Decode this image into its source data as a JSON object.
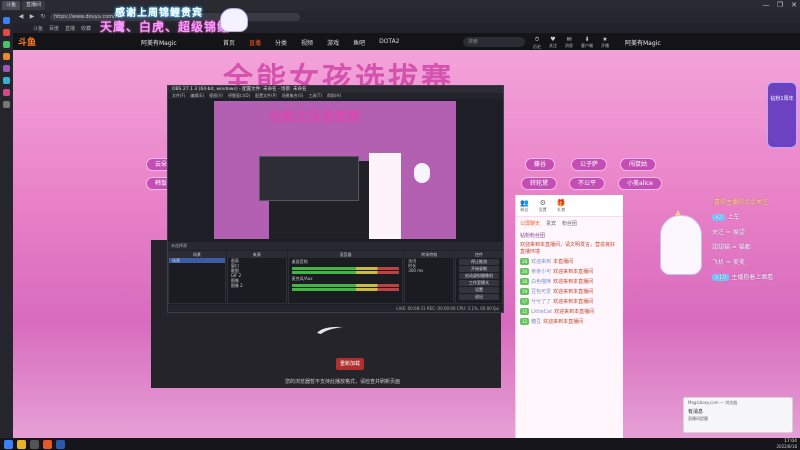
{
  "browser": {
    "tabs": [
      {
        "label": "斗鱼"
      },
      {
        "label": "直播间"
      }
    ],
    "window_controls": {
      "minimize": "—",
      "maximize": "❐",
      "close": "✕"
    },
    "url": "https://www.douyu.com/...",
    "bookmarks": [
      "斗鱼",
      "百度",
      "直播",
      "收藏"
    ]
  },
  "overlay": {
    "title": "感谢上周锦鲤贵宾",
    "subtitle": "天鹰、白虎、超级锦鲤"
  },
  "site": {
    "logo": "斗鱼",
    "streamer": "阿美有Magic",
    "nav": [
      {
        "label": "首页"
      },
      {
        "label": "直播",
        "active": true
      },
      {
        "label": "分类"
      },
      {
        "label": "视频"
      },
      {
        "label": "游戏"
      },
      {
        "label": "鱼吧"
      },
      {
        "label": "DOTA2"
      }
    ],
    "search_placeholder": "搜索",
    "header_icons": [
      {
        "icon": "⏱",
        "label": "历史"
      },
      {
        "icon": "♥",
        "label": "关注"
      },
      {
        "icon": "✉",
        "label": "消息"
      },
      {
        "icon": "⬇",
        "label": "客户端"
      },
      {
        "icon": "★",
        "label": "开播"
      }
    ],
    "user": "阿美有Magic"
  },
  "stage": {
    "title": "全能女孩选拔赛",
    "pills_left": [
      "云朵",
      "韩饭"
    ],
    "pills_right": [
      "藤谷",
      "公子萨",
      "闯鼠姑",
      "转轮黛",
      "不公平",
      "小美alice"
    ]
  },
  "player": {
    "button": "重新加载",
    "message": "您的浏览器暂不支持此播放格式，请检查并刷新页面"
  },
  "chat": {
    "top": [
      {
        "icon": "👥",
        "label": "粉丝"
      },
      {
        "icon": "⚙",
        "label": "设置"
      },
      {
        "icon": "🎁",
        "label": "礼物"
      }
    ],
    "tabs": [
      {
        "label": "公屏聊天",
        "active": true
      },
      {
        "label": "贵宾"
      },
      {
        "label": "粉丝团"
      }
    ],
    "rank": "钻粉粉丝团",
    "lines": [
      {
        "badge": "",
        "user": "",
        "text": "欢迎来到本直播间，请文明发言，营造良好直播环境"
      },
      {
        "badge": "28",
        "user": "欢迎来到",
        "text": "本直播间"
      },
      {
        "badge": "20",
        "user": "亲亲小可",
        "text": "欢迎来到本直播间"
      },
      {
        "badge": "18",
        "user": "白色喵咪",
        "text": "欢迎来到本直播间"
      },
      {
        "badge": "19",
        "user": "豆包可爱",
        "text": "欢迎来到本直播间"
      },
      {
        "badge": "17",
        "user": "兮兮了了",
        "text": "欢迎来到本直播间"
      },
      {
        "badge": "15",
        "user": "LittleCat",
        "text": "欢迎来到本直播间"
      },
      {
        "badge": "12",
        "user": "糖豆",
        "text": "欢迎来到本直播间"
      }
    ]
  },
  "side_panel": {
    "anniversary": "钻粉1周年",
    "gift_title": "喜欢主播的点点关注",
    "gift_lines": [
      {
        "badge": "x2",
        "text": "上车"
      },
      {
        "badge": "",
        "text": "关注 = 展望"
      },
      {
        "badge": "",
        "text": "甜甜猫 = 猫都"
      },
      {
        "badge": "",
        "text": "飞机 = 美美"
      },
      {
        "badge": "x10",
        "text": "主播抱着上面看"
      }
    ]
  },
  "obs": {
    "title": "OBS 27.1.3 (64-bit, windows) - 配置文件: 未命名 - 场景: 未命名",
    "menu": [
      "文件(F)",
      "编辑(E)",
      "视图(V)",
      "停靠窗口(D)",
      "配置文件(P)",
      "场景集合(S)",
      "工具(T)",
      "帮助(H)"
    ],
    "preview_title": "全能女孩选拔赛",
    "toolbar": "未选择源",
    "docks": {
      "scenes": {
        "header": "场景",
        "items": [
          "场景"
        ]
      },
      "sources": {
        "header": "来源",
        "items": [
          "画面",
          "窗口",
          "截图",
          "GIF 2",
          "图像",
          "图像 2"
        ]
      },
      "mixer": {
        "header": "混音器",
        "rows": [
          "桌面音频",
          "麦克风/Aux"
        ]
      },
      "transitions": {
        "header": "转场特效",
        "type": "淡出",
        "duration_label": "时长",
        "duration": "300 ms"
      },
      "controls": {
        "header": "控件",
        "buttons": [
          "停止推流",
          "开始录制",
          "启动虚拟摄像机",
          "工作室模式",
          "设置",
          "退出"
        ]
      }
    },
    "status": "LIVE: 00:08:31  REC: 00:00:00  CPU: 3.1%, 60.00 fps"
  },
  "notification": {
    "app": "Magicboxy.com — 浏览器",
    "title": "有消息",
    "subtitle": "直播间提醒"
  },
  "taskbar": {
    "time": "17:04",
    "date": "2022/8/18"
  }
}
